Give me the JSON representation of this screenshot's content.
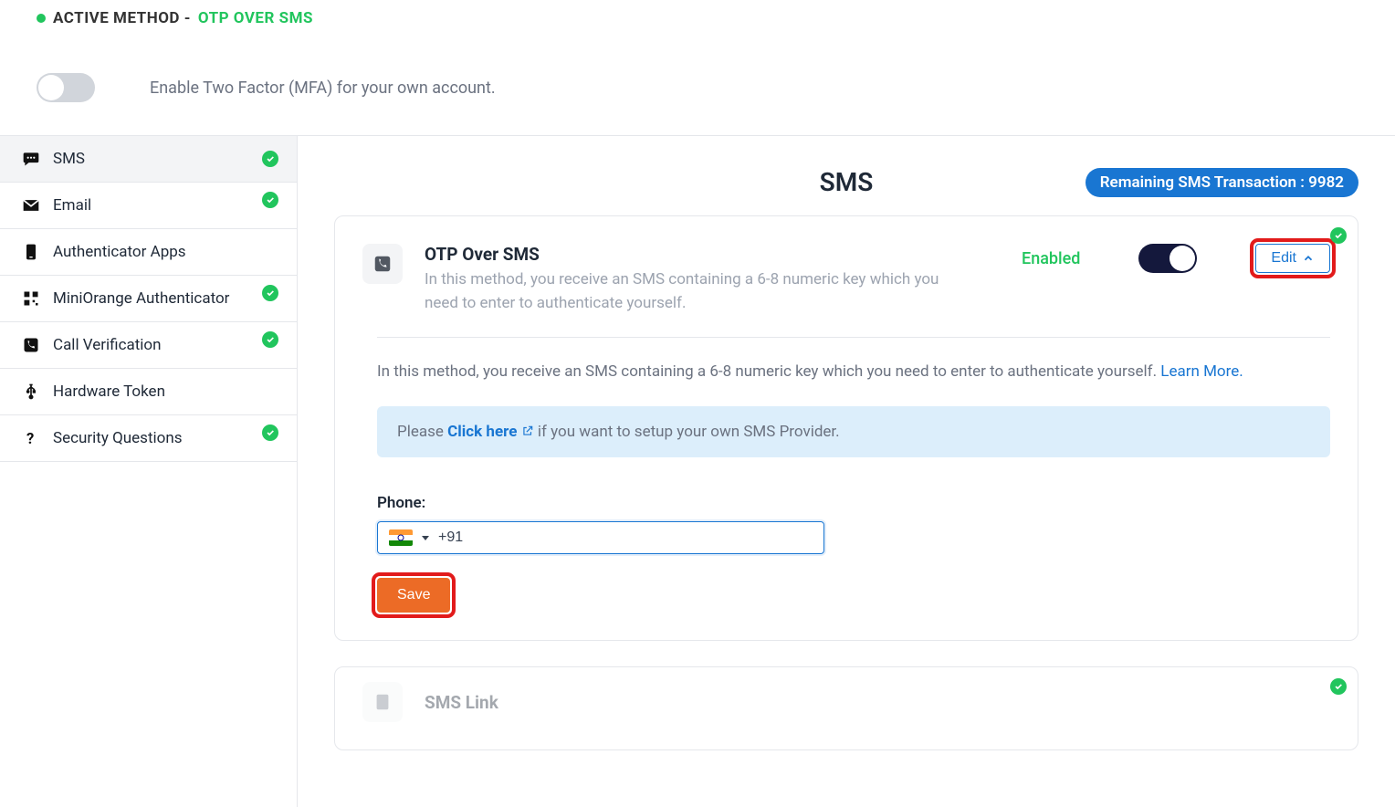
{
  "header": {
    "active_method_label": "ACTIVE METHOD - ",
    "active_method_value": "OTP OVER SMS",
    "mfa_enable_text": "Enable Two Factor (MFA) for your own account."
  },
  "sidebar": {
    "items": [
      {
        "label": "SMS",
        "icon": "chat-dots-icon",
        "checked": true,
        "active": true
      },
      {
        "label": "Email",
        "icon": "envelope-icon",
        "checked": true,
        "active": false
      },
      {
        "label": "Authenticator Apps",
        "icon": "phone-app-icon",
        "checked": false,
        "active": false
      },
      {
        "label": "MiniOrange Authenticator",
        "icon": "qr-icon",
        "checked": true,
        "active": false
      },
      {
        "label": "Call Verification",
        "icon": "phone-icon",
        "checked": true,
        "active": false
      },
      {
        "label": "Hardware Token",
        "icon": "usb-icon",
        "checked": false,
        "active": false
      },
      {
        "label": "Security Questions",
        "icon": "question-icon",
        "checked": true,
        "active": false
      }
    ]
  },
  "main": {
    "title": "SMS",
    "remaining_label": "Remaining SMS Transaction : ",
    "remaining_value": "9982",
    "card": {
      "title": "OTP Over SMS",
      "desc": "In this method, you receive an SMS containing a 6-8 numeric key which you need to enter to authenticate yourself.",
      "status": "Enabled",
      "edit_label": "Edit",
      "body_text": "In this method, you receive an SMS containing a 6-8 numeric key which you need to enter to authenticate yourself. ",
      "learn_more": "Learn More.",
      "info_prefix": "Please ",
      "info_link": "Click here ",
      "info_suffix": " if you want to setup your own SMS Provider.",
      "phone_label": "Phone:",
      "phone_value": "+91",
      "save_label": "Save"
    },
    "card2": {
      "title": "SMS Link"
    }
  }
}
